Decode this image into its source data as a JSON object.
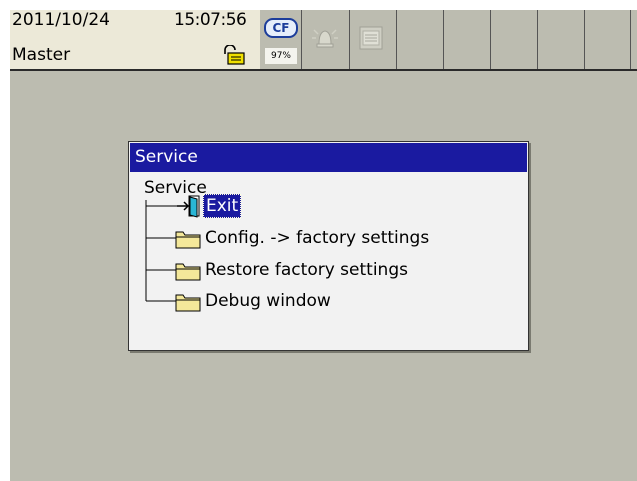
{
  "status_bar": {
    "date": "2011/10/24",
    "time": "15:07:56",
    "user": "Master",
    "storage_label": "CF",
    "storage_usage": "97%"
  },
  "dialog": {
    "title": "Service",
    "root_label": "Service",
    "items": [
      {
        "label": "Exit",
        "icon": "exit-door-icon",
        "selected": true
      },
      {
        "label": "Config. -> factory settings",
        "icon": "folder-icon",
        "selected": false
      },
      {
        "label": "Restore factory settings",
        "icon": "folder-icon",
        "selected": false
      },
      {
        "label": "Debug window",
        "icon": "folder-icon",
        "selected": false
      }
    ]
  },
  "colors": {
    "background": "#bcbcb0",
    "title_bar": "#1a1aa0",
    "selection": "#1a1aa0",
    "folder": "#f4e89a"
  }
}
